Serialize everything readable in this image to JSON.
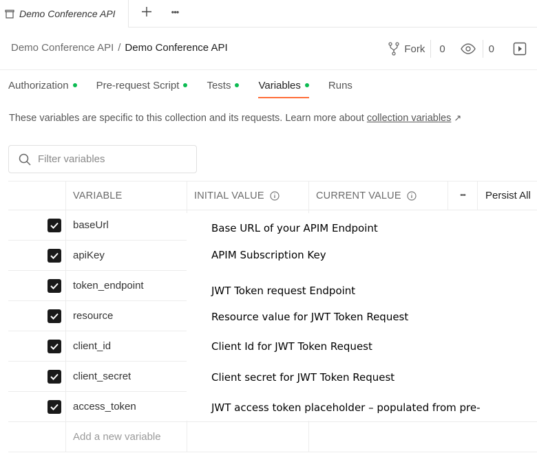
{
  "tab": {
    "title": "Demo Conference API"
  },
  "breadcrumb": {
    "parent": "Demo Conference API",
    "separator": "/",
    "current": "Demo Conference API"
  },
  "actions": {
    "fork_label": "Fork",
    "fork_count": "0",
    "watch_count": "0"
  },
  "subtabs": [
    {
      "label": "Authorization",
      "dot": true
    },
    {
      "label": "Pre-request Script",
      "dot": true
    },
    {
      "label": "Tests",
      "dot": true
    },
    {
      "label": "Variables",
      "dot": true,
      "active": true
    },
    {
      "label": "Runs",
      "dot": false
    }
  ],
  "description": {
    "text": "These variables are specific to this collection and its requests. Learn more about",
    "link": "collection variables",
    "link_icon": "↗"
  },
  "filter": {
    "placeholder": "Filter variables"
  },
  "table": {
    "headers": {
      "variable": "VARIABLE",
      "initial": "INITIAL VALUE",
      "current": "CURRENT VALUE",
      "more": "•••",
      "persist": "Persist All"
    },
    "rows": [
      {
        "name": "baseUrl",
        "checked": true,
        "note": "Base URL of your APIM Endpoint"
      },
      {
        "name": "apiKey",
        "checked": true,
        "note": "APIM Subscription Key"
      },
      {
        "name": "token_endpoint",
        "checked": true,
        "note": "JWT Token request Endpoint"
      },
      {
        "name": "resource",
        "checked": true,
        "note": "Resource value for JWT Token Request"
      },
      {
        "name": "client_id",
        "checked": true,
        "note": "Client Id for JWT Token Request"
      },
      {
        "name": "client_secret",
        "checked": true,
        "note": "Client secret for JWT Token Request"
      },
      {
        "name": "access_token",
        "checked": true,
        "note": "JWT access token placeholder – populated from pre-"
      }
    ],
    "add_placeholder": "Add a new variable"
  },
  "colors": {
    "accent": "#ff6c37",
    "dot": "#0cbb52",
    "checkbox": "#1a1a1a"
  }
}
